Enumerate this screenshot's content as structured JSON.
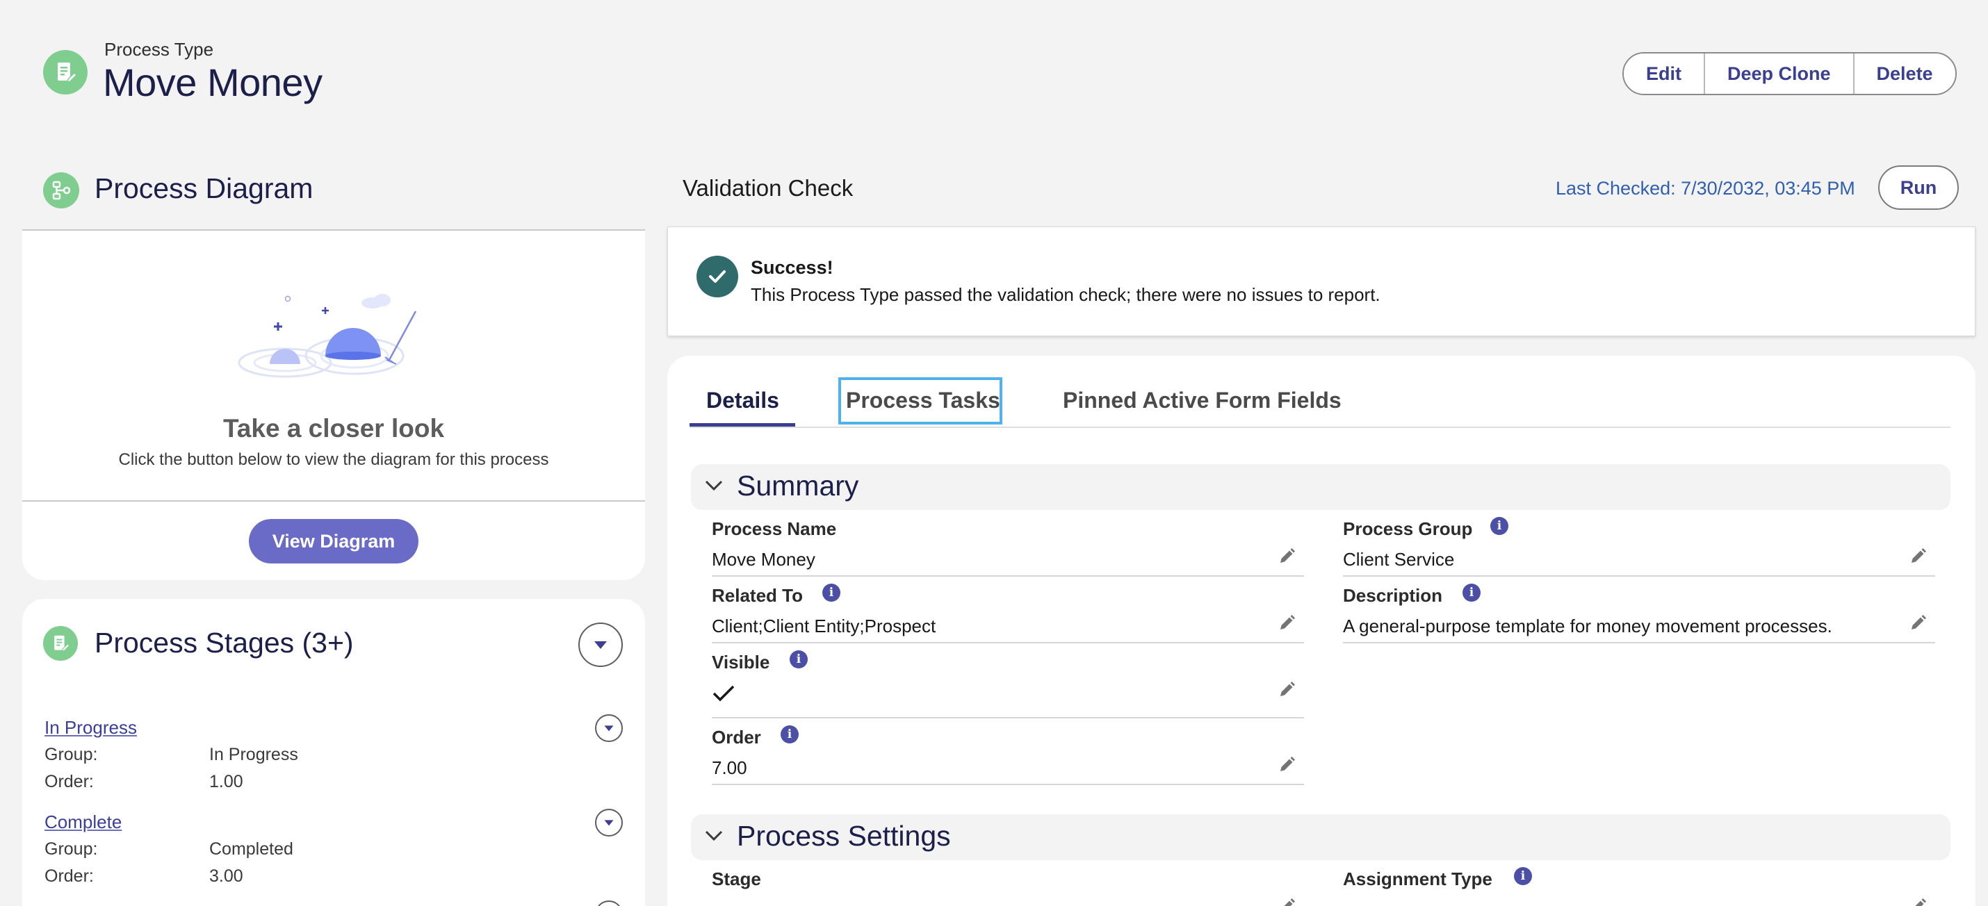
{
  "header": {
    "kicker": "Process Type",
    "title": "Move Money",
    "actions": [
      "Edit",
      "Deep Clone",
      "Delete"
    ]
  },
  "process_diagram": {
    "title": "Process Diagram",
    "heading": "Take a closer look",
    "subtext": "Click the button below to view the diagram for this process",
    "button": "View Diagram"
  },
  "process_stages": {
    "title": "Process Stages (3+)",
    "stages": [
      {
        "name": "In Progress",
        "group_label": "Group:",
        "group": "In Progress",
        "order_label": "Order:",
        "order": "1.00"
      },
      {
        "name": "Complete",
        "group_label": "Group:",
        "group": "Completed",
        "order_label": "Order:",
        "order": "3.00"
      }
    ]
  },
  "validation": {
    "title": "Validation Check",
    "last_checked": "Last Checked: 7/30/2032, 03:45 PM",
    "run_button": "Run",
    "status_title": "Success!",
    "status_message": "This Process Type passed the validation check; there were no issues to report."
  },
  "tabs": [
    "Details",
    "Process Tasks",
    "Pinned Active Form Fields"
  ],
  "summary": {
    "title": "Summary",
    "process_name_label": "Process Name",
    "process_name": "Move Money",
    "process_group_label": "Process Group",
    "process_group": "Client Service",
    "related_to_label": "Related To",
    "related_to": "Client;Client Entity;Prospect",
    "description_label": "Description",
    "description": "A general-purpose template for money movement processes.",
    "visible_label": "Visible",
    "visible": true,
    "order_label": "Order",
    "order": "7.00"
  },
  "process_settings": {
    "title": "Process Settings",
    "stage_label": "Stage",
    "assignment_type_label": "Assignment Type"
  },
  "colors": {
    "brand": "#3a3f8f",
    "button_primary": "#6a6bc7",
    "success": "#2e6b6a",
    "icon_bg": "#7fce8f",
    "focus": "#4fb3ea"
  },
  "icons": {
    "header": "process-type-icon",
    "diagram": "process-diagram-icon",
    "stages": "process-stages-icon",
    "info": "info-icon",
    "edit": "pencil-icon",
    "success": "check-circle-icon"
  }
}
